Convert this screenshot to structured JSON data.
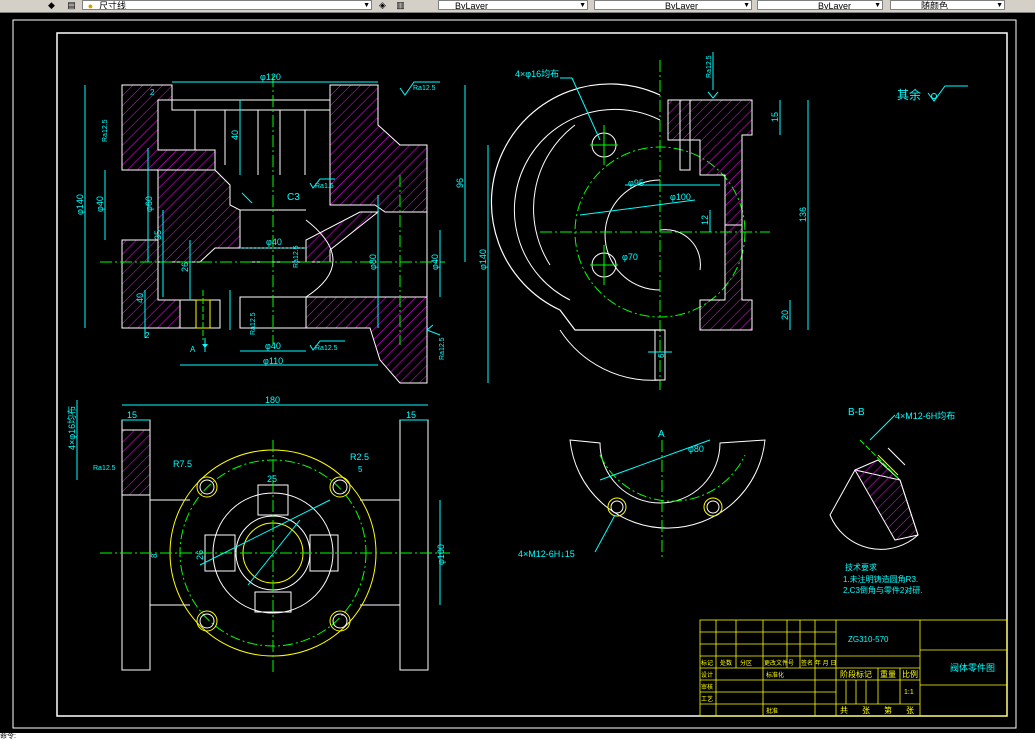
{
  "toolbar": {
    "layer_combo": "尺寸线",
    "color_combo": "ByLayer",
    "linetype_combo": "ByLayer",
    "lineweight_combo": "ByLayer",
    "plotstyle_combo": "随颜色"
  },
  "drawing": {
    "roughness_rest_label": "其余",
    "section_bb_label": "B-B",
    "section_a_label": "A",
    "view_a_marker": "A",
    "front": {
      "d120": "φ120",
      "d140": "φ140",
      "d40_left": "φ40",
      "d60": "φ60",
      "d40_mid": "φ40",
      "d40_bottom": "φ40",
      "d110": "φ110",
      "d80": "φ80",
      "d40_right": "φ40",
      "d140_right": "φ140",
      "dim40_top": "40",
      "dim96": "96",
      "dim35": "35",
      "dim26": "26",
      "dim40_low": "40",
      "dim2_top": "2",
      "dim2_bot": "2",
      "c3": "C3",
      "ra125_top": "Ra12.5",
      "ra125_a": "Ra12.5",
      "ra16": "Ra1.6",
      "ra125_mid": "Ra12.5",
      "ra125_b": "Ra12.5",
      "ra125_c": "Ra12.5",
      "ra125_d": "Ra12.5"
    },
    "side": {
      "bolt_holes": "4×φ16均布",
      "d95": "φ95",
      "d100": "φ100",
      "d70": "φ70",
      "dim15": "15",
      "dim136": "136",
      "dim20": "20",
      "dim12": "12",
      "dim6": "6",
      "ra125": "Ra12.5"
    },
    "bottom": {
      "dim180": "180",
      "dim15_left": "15",
      "dim15_right": "15",
      "holes_vertical": "4×φ16均布",
      "r75": "R7.5",
      "r25": "R2.5",
      "dim25": "25",
      "dim26": "26",
      "dim5": "5",
      "dim8": "8",
      "d100": "φ100",
      "ra125": "Ra12.5"
    },
    "arc_view": {
      "d80": "φ80",
      "m12_thread": "4×M12-6H↓15"
    },
    "bb_view": {
      "m12_thread": "4×M12-6H均布"
    },
    "tech_notes": {
      "title": "技术要求",
      "line1": "1.未注明铸造圆角R3.",
      "line2": "2.C3倒角与零件2对研."
    },
    "title_block": {
      "material": "ZG310-570",
      "part_name": "阀体零件图",
      "scale_value": "1:1",
      "h_mark": "标记",
      "h_count": "处数",
      "h_zone": "分区",
      "h_doc": "更改文件号",
      "h_sign": "签名",
      "h_date": "年 月 日",
      "design": "设计",
      "standardize": "标准化",
      "check": "审核",
      "craft": "工艺",
      "approve": "批准",
      "stage_mark": "阶段标记",
      "weight": "重量",
      "scale": "比例",
      "sheets_total": "共",
      "sheet_word1": "张",
      "sheets_no": "第",
      "sheet_word2": "张"
    }
  },
  "colors": {
    "outline": "#ffffff",
    "dimension": "#00ffff",
    "centerline": "#00ff00",
    "hatch": "#ff00ff",
    "hidden": "#ffff00",
    "title": "#ffff00"
  },
  "cmdline": {
    "text": "命令:"
  }
}
